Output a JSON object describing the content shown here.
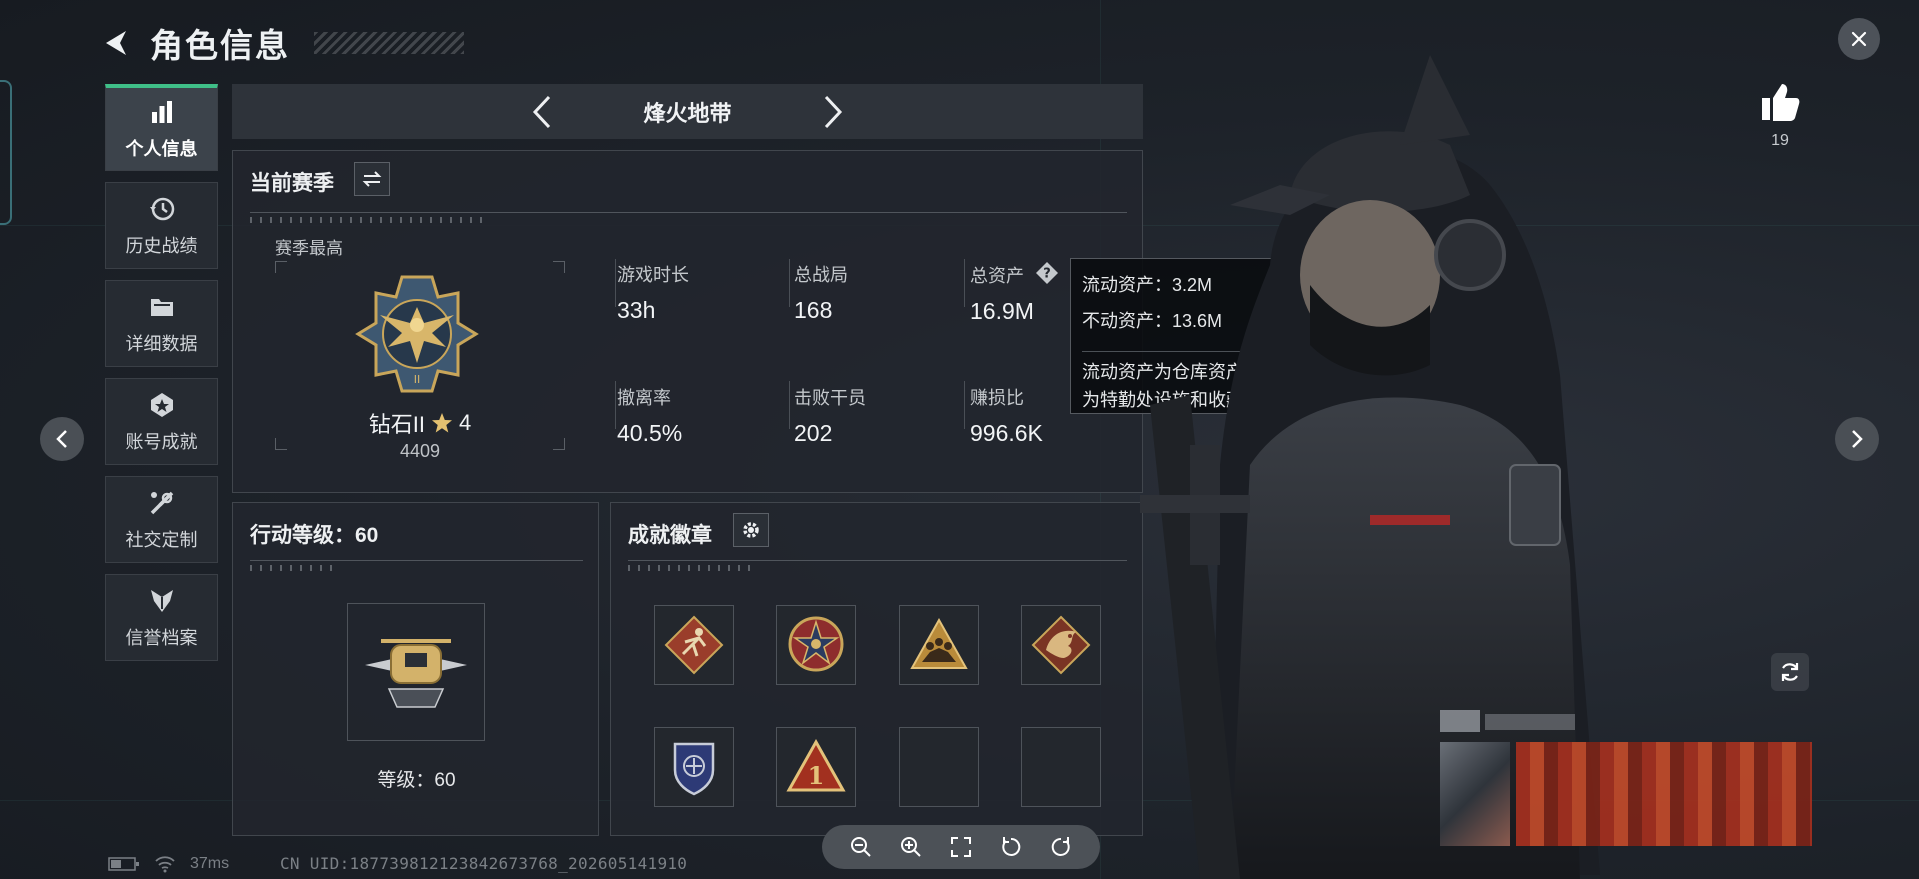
{
  "header": {
    "title": "角色信息"
  },
  "nav": {
    "items": [
      {
        "label": "个人信息",
        "icon": "bar-chart-icon",
        "active": true
      },
      {
        "label": "历史战绩",
        "icon": "history-icon",
        "active": false
      },
      {
        "label": "详细数据",
        "icon": "folder-icon",
        "active": false
      },
      {
        "label": "账号成就",
        "icon": "achievement-icon",
        "active": false
      },
      {
        "label": "社交定制",
        "icon": "tools-icon",
        "active": false
      },
      {
        "label": "信誉档案",
        "icon": "credit-icon",
        "active": false
      }
    ]
  },
  "mode": {
    "title": "烽火地带"
  },
  "season": {
    "title": "当前赛季",
    "best_label": "赛季最高",
    "rank_name": "钻石II",
    "rank_stars": "4",
    "rank_points": "4409",
    "stats": [
      {
        "label": "游戏时长",
        "value": "33h"
      },
      {
        "label": "总战局",
        "value": "168"
      },
      {
        "label": "总资产",
        "value": "16.9M"
      },
      {
        "label": "撤离率",
        "value": "40.5%"
      },
      {
        "label": "击败干员",
        "value": "202"
      },
      {
        "label": "赚损比",
        "value": "996.6K"
      }
    ]
  },
  "tooltip": {
    "line1": "流动资产：3.2M",
    "line2": "不动资产：13.6M",
    "desc_line1": "流动资产为仓库资产和哈夫币，不动资产",
    "desc_line2": "为特勤处设施和收藏室设施"
  },
  "action_level": {
    "title": "行动等级：60",
    "level_text": "等级：60"
  },
  "badges": {
    "title": "成就徽章",
    "slots": [
      "badge-runner",
      "badge-star-medal",
      "badge-squad",
      "badge-dragon",
      "badge-shield",
      "badge-rank-one",
      "",
      ""
    ]
  },
  "likes": {
    "count": "19"
  },
  "status": {
    "ping": "37ms",
    "uid": "CN UID:18773981212384267376​8_202605141910"
  },
  "colors": {
    "accent": "#3fbf88",
    "panel": "#22262d",
    "gold": "#c9a65a"
  }
}
